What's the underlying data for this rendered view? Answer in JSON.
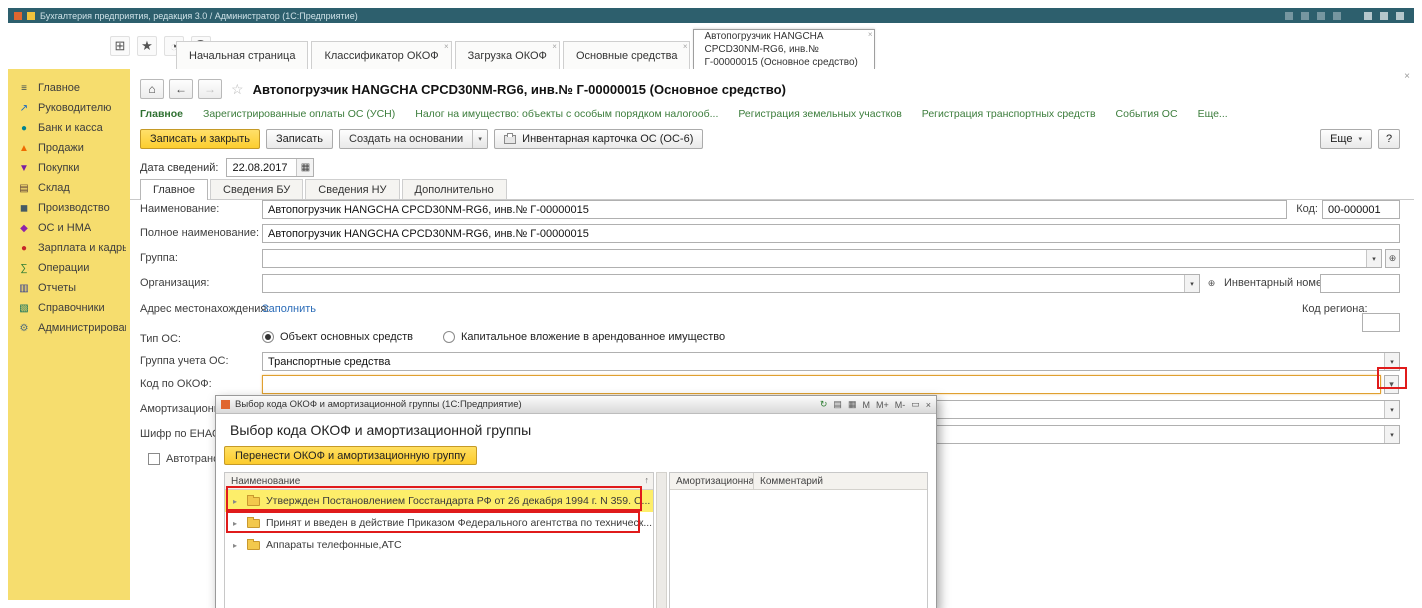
{
  "titlebar": {
    "title": "Бухгалтерия предприятия, редакция 3.0 / Администратор (1С:Предприятие)"
  },
  "icons": {
    "grid": "⊞",
    "star": "★",
    "clock": "◔",
    "home": "⌂",
    "back": "←",
    "forward": "→",
    "favorite": "☆",
    "dropdown": "▾",
    "calendar": "▦",
    "plus": "⊕",
    "close": "×",
    "sort_up": "↑",
    "expand": "▸"
  },
  "tabs": [
    {
      "label": "Начальная страница"
    },
    {
      "label": "Классификатор ОКОФ"
    },
    {
      "label": "Загрузка ОКОФ"
    },
    {
      "label": "Основные средства"
    },
    {
      "label": "Автопогрузчик HANGCHA CPCD30NM-RG6, инв.№ Г-00000015 (Основное средство)"
    }
  ],
  "sidebar": {
    "items": [
      {
        "label": "Главное",
        "icon": "≡",
        "color": "#37474f"
      },
      {
        "label": "Руководителю",
        "icon": "↗",
        "color": "#1565c0"
      },
      {
        "label": "Банк и касса",
        "icon": "●",
        "color": "#00838f"
      },
      {
        "label": "Продажи",
        "icon": "▲",
        "color": "#ef6c00"
      },
      {
        "label": "Покупки",
        "icon": "▼",
        "color": "#7b1fa2"
      },
      {
        "label": "Склад",
        "icon": "▤",
        "color": "#5d4037"
      },
      {
        "label": "Производство",
        "icon": "◼",
        "color": "#455a64"
      },
      {
        "label": "ОС и НМА",
        "icon": "◆",
        "color": "#8e24aa"
      },
      {
        "label": "Зарплата и кадры",
        "icon": "●",
        "color": "#c62828"
      },
      {
        "label": "Операции",
        "icon": "∑",
        "color": "#2e7d32"
      },
      {
        "label": "Отчеты",
        "icon": "▥",
        "color": "#283593"
      },
      {
        "label": "Справочники",
        "icon": "▧",
        "color": "#00695c"
      },
      {
        "label": "Администрирование",
        "icon": "⚙",
        "color": "#546e7a"
      }
    ]
  },
  "page": {
    "title": "Автопогрузчик HANGCHA CPCD30NM-RG6, инв.№ Г-00000015 (Основное средство)",
    "links": [
      "Главное",
      "Зарегистрированные оплаты ОС (УСН)",
      "Налог на имущество: объекты с особым порядком налогооб...",
      "Регистрация земельных участков",
      "Регистрация транспортных средств",
      "События ОС",
      "Еще..."
    ],
    "toolbar": {
      "save_close": "Записать и закрыть",
      "save": "Записать",
      "create_from": "Создать на основании",
      "inventory_card": "Инвентарная карточка ОС (ОС-6)",
      "more": "Еще",
      "help": "?"
    },
    "date_label": "Дата сведений:",
    "date_value": "22.08.2017",
    "form_tabs": [
      "Главное",
      "Сведения БУ",
      "Сведения НУ",
      "Дополнительно"
    ],
    "fields": {
      "name_label": "Наименование:",
      "name_value": "Автопогрузчик HANGCHA CPCD30NM-RG6, инв.№ Г-00000015",
      "code_label": "Код:",
      "code_value": "00-000001",
      "fullname_label": "Полное наименование:",
      "fullname_value": "Автопогрузчик HANGCHA CPCD30NM-RG6, инв.№ Г-00000015",
      "group_label": "Группа:",
      "org_label": "Организация:",
      "inv_label": "Инвентарный номер:",
      "addr_label": "Адрес местонахождения:",
      "addr_link": "Заполнить",
      "region_label": "Код региона:",
      "type_label": "Тип ОС:",
      "type_opt1": "Объект основных средств",
      "type_opt2": "Капитальное вложение в арендованное имущество",
      "acc_group_label": "Группа учета ОС:",
      "acc_group_value": "Транспортные средства",
      "okof_label": "Код по ОКОФ:",
      "amort_label": "Амортизационная группа:",
      "enaof_label": "Шифр по ЕНАОФ:",
      "autotrans_label": "Автотранспорт"
    }
  },
  "dialog": {
    "title": "Выбор кода ОКОФ и амортизационной группы (1С:Предприятие)",
    "heading": "Выбор кода ОКОФ и амортизационной группы",
    "transfer_button": "Перенести ОКОФ и амортизационную группу",
    "controls": [
      "↻",
      "▤",
      "▦",
      "М",
      "М+",
      "М-",
      "▭",
      "×"
    ],
    "columns": [
      "Наименование",
      "Амортизационная гру...",
      "Комментарий"
    ],
    "rows": [
      {
        "label": "Утвержден Постановлением Госстандарта РФ от 26 декабря 1994 г. N 359. С...",
        "highlighted": true
      },
      {
        "label": "Принят и введен в действие Приказом Федерального агентства по техническ...",
        "highlighted": false
      },
      {
        "label": "Аппараты телефонные,АТС",
        "highlighted": false
      }
    ]
  },
  "colors": {
    "titlebar": "#2d5f6d",
    "sidebar_yellow": "#f6dd6e",
    "accent_yellow": "#fcce2f",
    "selected_row": "#fdee6a",
    "annotation_red": "#e01b1b",
    "link_green": "#3c7d3c"
  }
}
